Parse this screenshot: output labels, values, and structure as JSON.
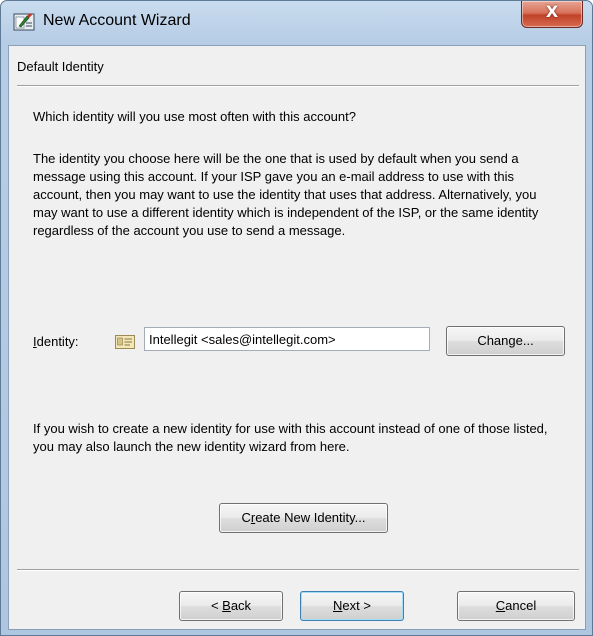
{
  "window": {
    "title": "New Account Wizard",
    "close_label": "X"
  },
  "page": {
    "header": "Default Identity",
    "question": "Which identity will you use most often with this account?",
    "description": "The identity you choose here will be the one that is used by default when you send a message using this account.  If your ISP gave you an e-mail address to use with this account, then you may want to use the identity that uses that address.  Alternatively, you may want to use a different identity which is independent of the ISP, or the same identity regardless of the account you use to send a message.",
    "identity": {
      "label_accel": "I",
      "label_rest": "dentity:",
      "value": "Intellegit <sales@intellegit.com>",
      "icon": "vcard-icon"
    },
    "change_button": "Change...",
    "wish_text": "If you wish to create a new identity for use with this account instead of one of those listed, you may also launch the new identity wizard from here.",
    "create_button": {
      "accel": "r",
      "prefix": "C",
      "rest": "eate New Identity..."
    }
  },
  "footer": {
    "back": {
      "prefix": "< ",
      "accel": "B",
      "rest": "ack"
    },
    "next": {
      "accel": "N",
      "rest": "ext >"
    },
    "cancel": {
      "accel": "C",
      "rest": "ancel"
    }
  }
}
